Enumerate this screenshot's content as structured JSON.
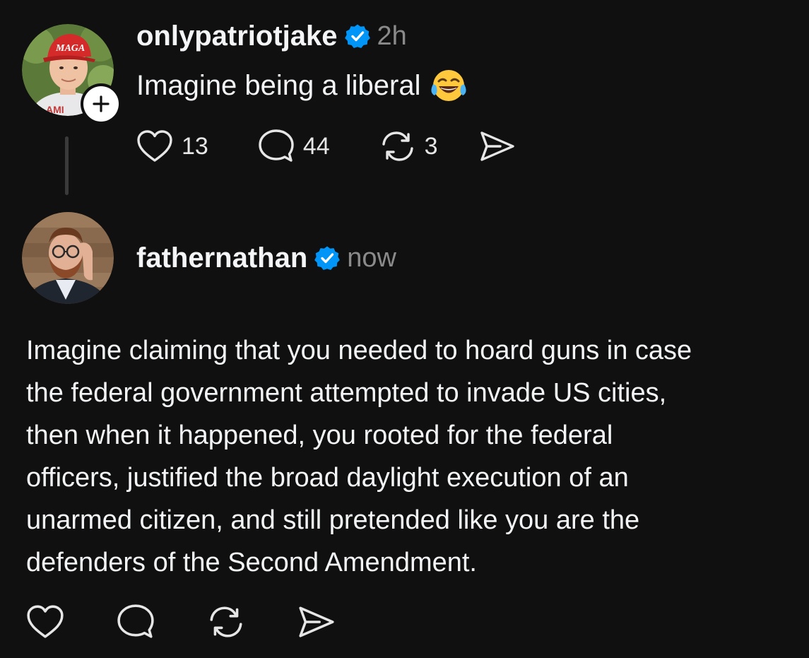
{
  "posts": [
    {
      "username": "onlypatriotjake",
      "verified": true,
      "timestamp": "2h",
      "text": "Imagine being a liberal",
      "emoji": "tears-of-joy-emoji",
      "stats": {
        "likes": "13",
        "replies": "44",
        "reposts": "3"
      },
      "avatar_hat_text": "MAGA",
      "show_follow_button": true
    },
    {
      "username": "fathernathan",
      "verified": true,
      "timestamp": "now",
      "text_lines": [
        "Imagine claiming that you needed to hoard guns in case",
        "the federal government attempted to invade US cities,",
        "then when it happened, you rooted for the federal",
        "officers, justified the broad daylight execution of an",
        "unarmed citizen, and still pretended like you are the",
        "defenders of the Second Amendment."
      ]
    }
  ],
  "colors": {
    "background": "#101010",
    "text": "#f3f5f7",
    "muted": "#8a8a8a",
    "verified": "#0095f6",
    "thread_line": "#3a3a3a"
  },
  "icons": [
    "heart-icon",
    "comment-icon",
    "repost-icon",
    "share-icon",
    "verified-badge-icon",
    "plus-icon"
  ]
}
